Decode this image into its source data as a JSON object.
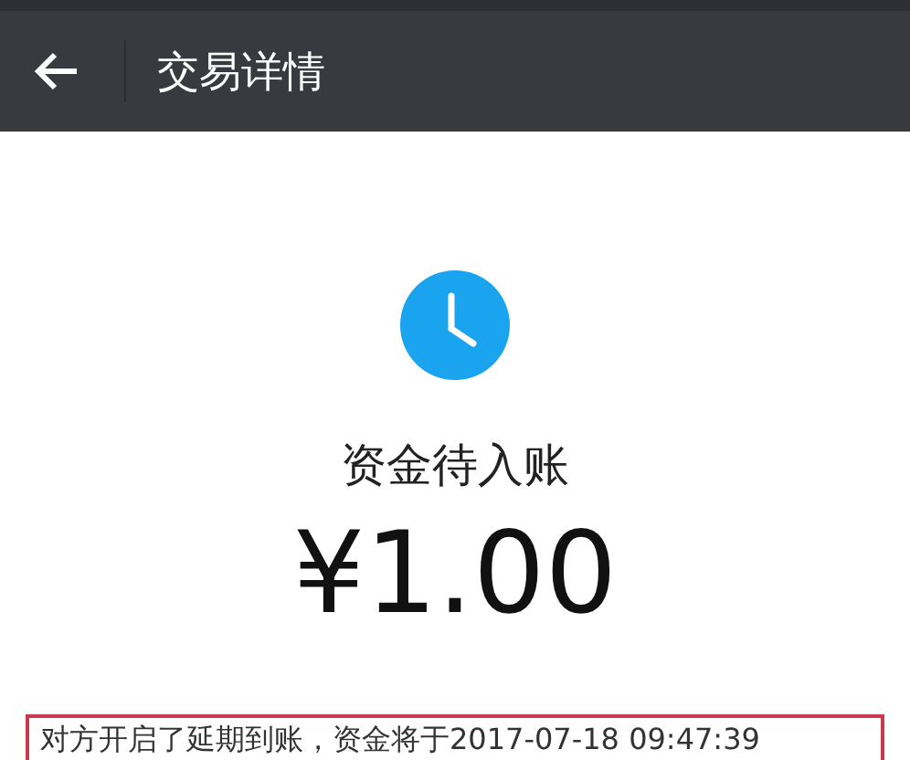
{
  "header": {
    "title": "交易详情"
  },
  "status": {
    "label": "资金待入账"
  },
  "amount": "¥1.00",
  "notice": "对方开启了延期到账，资金将于2017-07-18 09:47:39"
}
